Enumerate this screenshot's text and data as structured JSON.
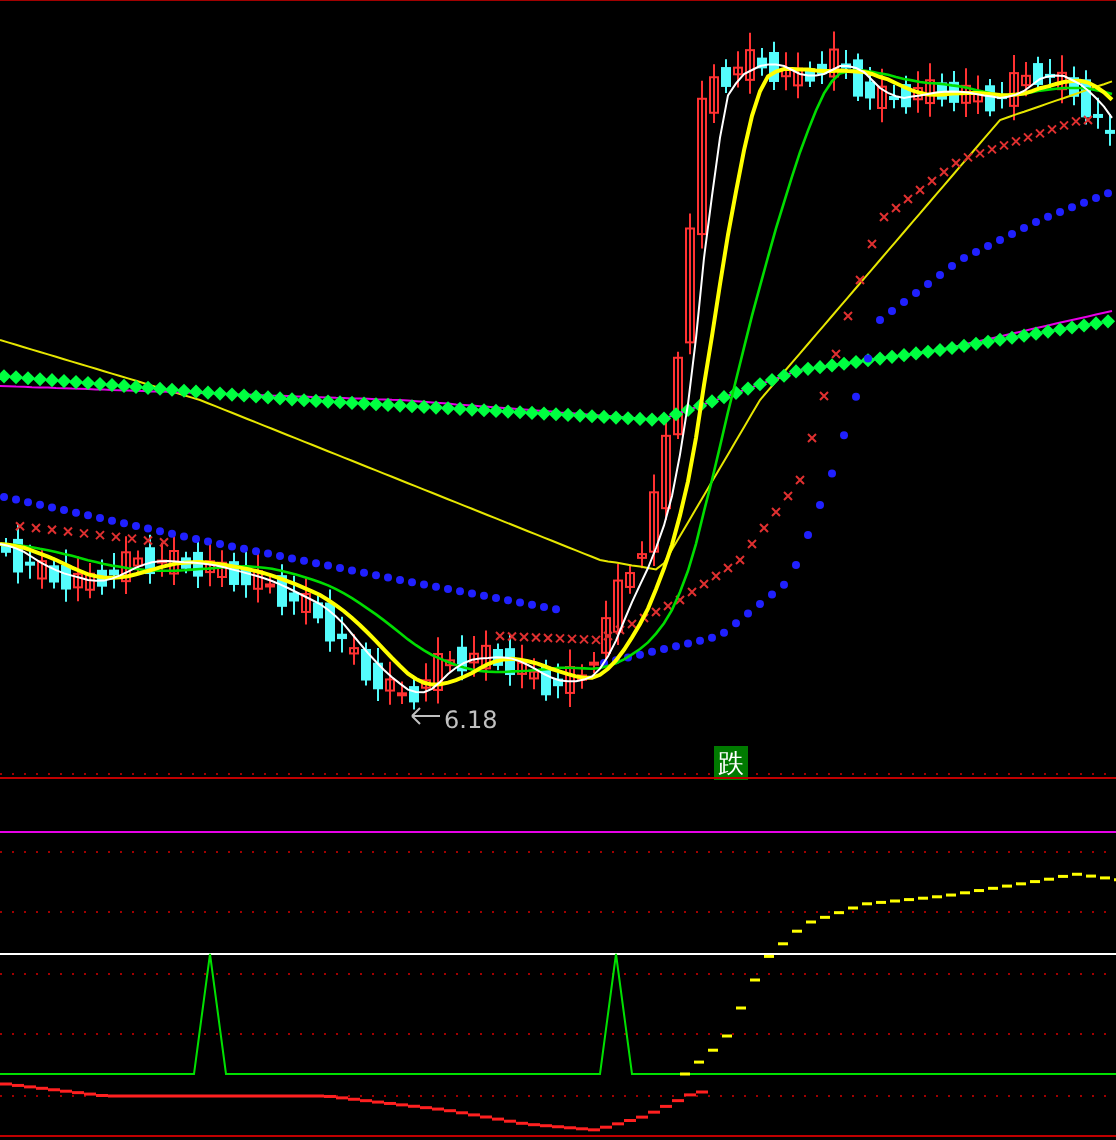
{
  "price_panel": {
    "low_label": "6.18",
    "signal_label": "跌"
  }
}
